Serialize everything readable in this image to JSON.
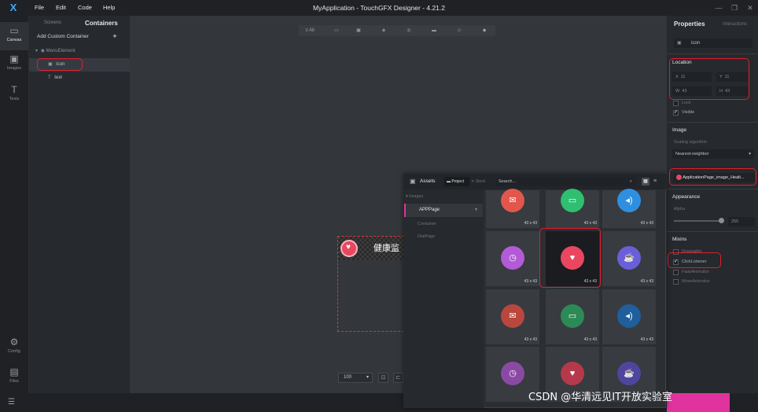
{
  "window": {
    "title": "MyApplication - TouchGFX Designer - 4.21.2",
    "menu": [
      "File",
      "Edit",
      "Code",
      "Help"
    ],
    "controls": [
      "minimize",
      "restore",
      "close"
    ]
  },
  "rail": {
    "items": [
      {
        "label": "Canvas",
        "icon": "canvas-icon",
        "glyph": "▭"
      },
      {
        "label": "Images",
        "icon": "image-icon",
        "glyph": "▣"
      },
      {
        "label": "Texts",
        "icon": "text-icon",
        "glyph": "T"
      },
      {
        "label": "Config",
        "icon": "gear-icon",
        "glyph": "⚙"
      },
      {
        "label": "Files",
        "icon": "folder-icon",
        "glyph": "▤"
      }
    ]
  },
  "tree": {
    "tab_screens": "Screens",
    "tab_containers": "Containers",
    "add_label": "Add Custom Container",
    "add_icon": "+",
    "root": "MenuElement",
    "children": [
      "icon",
      "text"
    ]
  },
  "toolbar": {
    "all_label": "All"
  },
  "canvas": {
    "text_preview": "健康监",
    "zoom": "100"
  },
  "properties": {
    "title": "Properties",
    "tab_interactions": "Interactions",
    "name": "icon",
    "location_header": "Location",
    "x_label": "X",
    "x": "11",
    "y_label": "Y",
    "y": "11",
    "w_label": "W",
    "w": "43",
    "h_label": "H",
    "h": "43",
    "lock": "Lock",
    "visible": "Visible",
    "image_header": "Image",
    "scaling_label": "Scaling algorithm",
    "scaling_value": "Nearest-neighbor",
    "image_value": "ApplicationPage_image_Healt...",
    "appearance_header": "Appearance",
    "alpha_label": "Alpha",
    "alpha_value": "255",
    "mixins_header": "Mixins",
    "mixins": [
      "Draggable",
      "ClickListener",
      "FadeAnimator",
      "MoveAnimator"
    ]
  },
  "assets": {
    "title": "Assets",
    "tab_project": "Project",
    "tab_stock": "Stock",
    "search_placeholder": "Search...",
    "folder_root": "Images",
    "folders": [
      "APPPage",
      "Container",
      "DialPage"
    ],
    "tile_size": "43 x 43",
    "tiles": [
      {
        "color": "#e2574c",
        "icon": "chat-icon",
        "glyph": "✉"
      },
      {
        "color": "#2fbf71",
        "icon": "battery-icon",
        "glyph": "▭"
      },
      {
        "color": "#2e8fe0",
        "icon": "speaker-icon",
        "glyph": "◂)"
      },
      {
        "color": "#b35bd6",
        "icon": "clock-icon",
        "glyph": "◷"
      },
      {
        "color": "#e8475f",
        "icon": "heart-icon",
        "glyph": "♥"
      },
      {
        "color": "#6a5fd8",
        "icon": "teapot-icon",
        "glyph": "☕"
      },
      {
        "color": "#b9473e",
        "icon": "chat-icon",
        "glyph": "✉"
      },
      {
        "color": "#2b8a55",
        "icon": "battery-icon",
        "glyph": "▭"
      },
      {
        "color": "#1f5f9c",
        "icon": "speaker-icon",
        "glyph": "◂)"
      },
      {
        "color": "#8a4aa3",
        "icon": "clock-icon",
        "glyph": "◷"
      },
      {
        "color": "#b5394c",
        "icon": "heart-icon",
        "glyph": "♥"
      },
      {
        "color": "#4e469e",
        "icon": "teapot-icon",
        "glyph": "☕"
      }
    ]
  },
  "watermark": "CSDN @华清远见IT开放实验室"
}
